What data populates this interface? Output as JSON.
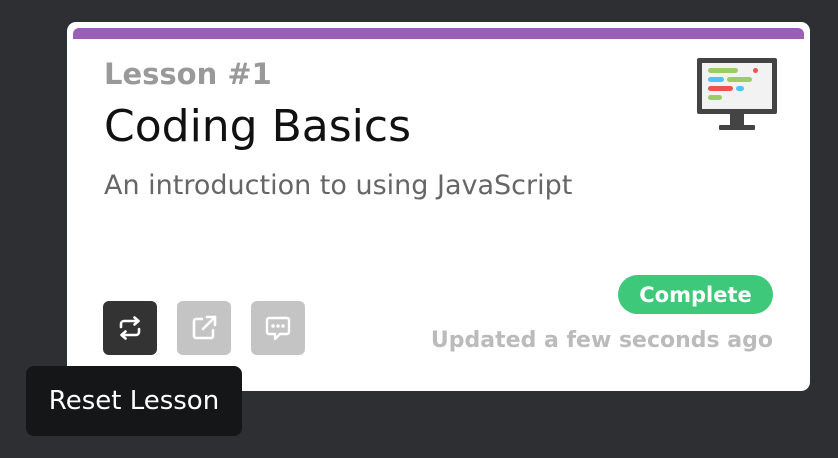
{
  "card": {
    "lesson_number": "Lesson #1",
    "title": "Coding Basics",
    "description": "An introduction to using JavaScript",
    "status": "Complete",
    "updated": "Updated a few seconds ago",
    "accent_color": "#9b5fb5",
    "status_color": "#3ec97a",
    "illustration": "computer-monitor-icon"
  },
  "actions": [
    {
      "icon": "repeat-icon",
      "active": true,
      "color": "#333333"
    },
    {
      "icon": "external-link-icon",
      "active": false,
      "color": "#c4c4c4"
    },
    {
      "icon": "comment-icon",
      "active": false,
      "color": "#c4c4c4"
    }
  ],
  "tooltip": {
    "text": "Reset Lesson"
  }
}
